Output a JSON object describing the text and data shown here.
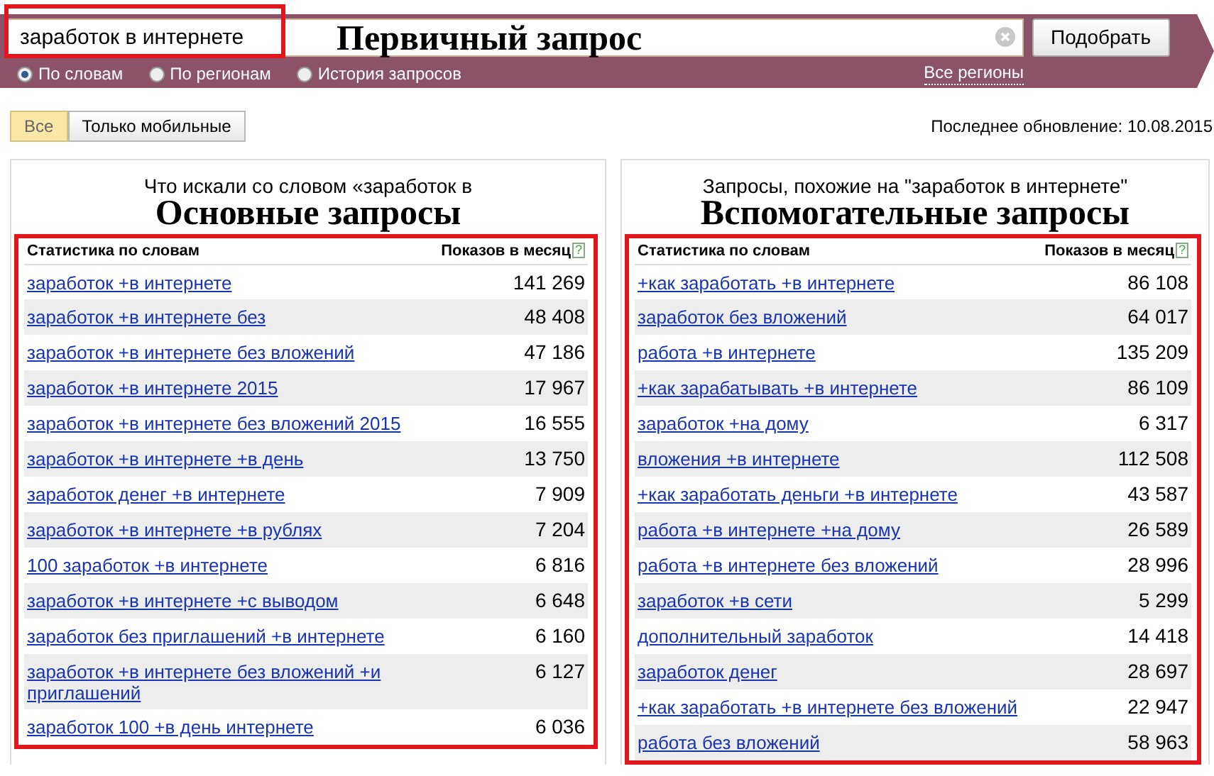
{
  "search": {
    "value": "заработок в интернете",
    "annotation": "Первичный запрос",
    "button": "Подобрать"
  },
  "search_modes": [
    {
      "label": "По словам",
      "selected": true
    },
    {
      "label": "По регионам",
      "selected": false
    },
    {
      "label": "История запросов",
      "selected": false
    }
  ],
  "regions_link": "Все регионы",
  "device_filter": [
    {
      "label": "Все",
      "selected": true
    },
    {
      "label": "Только мобильные",
      "selected": false
    }
  ],
  "last_update": "Последнее обновление: 10.08.2015",
  "panels": [
    {
      "heading": "Что искали со словом «заработок в",
      "annotation": "Основные запросы",
      "columns": [
        "Статистика по словам",
        "Показов в месяц"
      ],
      "help": "?",
      "rows": [
        {
          "query": "заработок +в интернете",
          "count": "141 269"
        },
        {
          "query": "заработок +в интернете без",
          "count": "48 408"
        },
        {
          "query": "заработок +в интернете без вложений",
          "count": "47 186"
        },
        {
          "query": "заработок +в интернете 2015",
          "count": "17 967"
        },
        {
          "query": "заработок +в интернете без вложений 2015",
          "count": "16 555"
        },
        {
          "query": "заработок +в интернете +в день",
          "count": "13 750"
        },
        {
          "query": "заработок денег +в интернете",
          "count": "7 909"
        },
        {
          "query": "заработок +в интернете +в рублях",
          "count": "7 204"
        },
        {
          "query": "100 заработок +в интернете",
          "count": "6 816"
        },
        {
          "query": "заработок +в интернете +с выводом",
          "count": "6 648"
        },
        {
          "query": "заработок без приглашений +в интернете",
          "count": "6 160"
        },
        {
          "query": "заработок +в интернете без вложений +и приглашений",
          "count": "6 127"
        },
        {
          "query": "заработок 100 +в день интернете",
          "count": "6 036"
        }
      ]
    },
    {
      "heading": "Запросы, похожие на \"заработок в интернете\"",
      "annotation": "Вспомогательные запросы",
      "columns": [
        "Статистика по словам",
        "Показов в месяц"
      ],
      "help": "?",
      "rows": [
        {
          "query": "+как заработать +в интернете",
          "count": "86 108"
        },
        {
          "query": "заработок без вложений",
          "count": "64 017"
        },
        {
          "query": "работа +в интернете",
          "count": "135 209"
        },
        {
          "query": "+как зарабатывать +в интернете",
          "count": "86 109"
        },
        {
          "query": "заработок +на дому",
          "count": "6 317"
        },
        {
          "query": "вложения +в интернете",
          "count": "112 508"
        },
        {
          "query": "+как заработать деньги +в интернете",
          "count": "43 587"
        },
        {
          "query": "работа +в интернете +на дому",
          "count": "26 589"
        },
        {
          "query": "работа +в интернете без вложений",
          "count": "28 996"
        },
        {
          "query": "заработок +в сети",
          "count": "5 299"
        },
        {
          "query": "дополнительный заработок",
          "count": "14 418"
        },
        {
          "query": "заработок денег",
          "count": "28 697"
        },
        {
          "query": "+как заработать +в интернете без вложений",
          "count": "22 947"
        },
        {
          "query": "работа без вложений",
          "count": "58 963"
        }
      ]
    }
  ]
}
